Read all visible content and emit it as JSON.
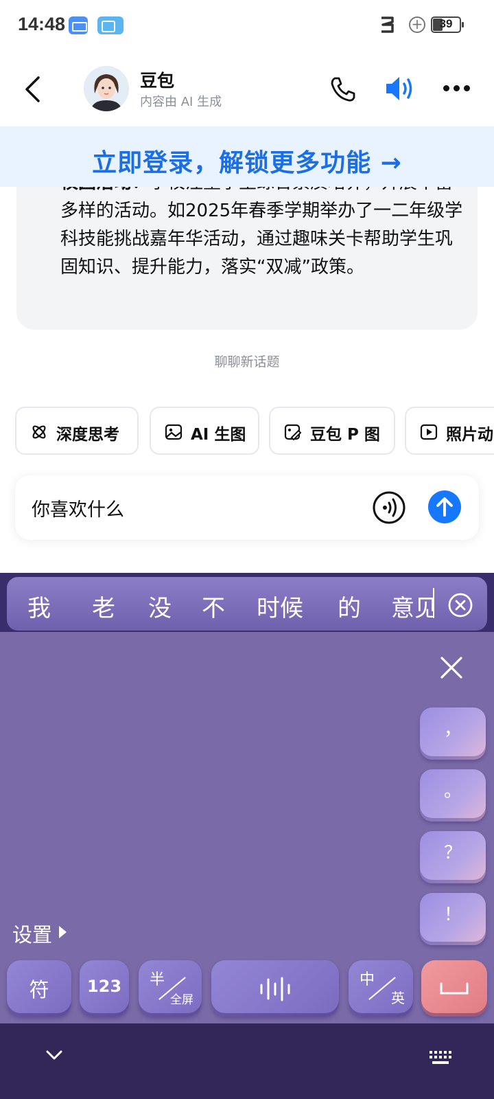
{
  "status_bar": {
    "time": "14:48",
    "battery": "39"
  },
  "header": {
    "title": "豆包",
    "subtitle": "内容由 AI 生成"
  },
  "banner": {
    "text": "立即登录，解锁更多功能 →"
  },
  "message": {
    "bold_prefix": "校园活动",
    "text": "：学校注重学生综合素质培养，开展丰富多样的活动。如2025年春季学期举办了一二年级学科技能挑战嘉年华活动，通过趣味关卡帮助学生巩固知识、提升能力，落实“双减”政策。"
  },
  "new_topic": "聊聊新话题",
  "chips": [
    {
      "label": "深度思考",
      "icon": "atom-icon"
    },
    {
      "label": "AI 生图",
      "icon": "image-icon"
    },
    {
      "label": "豆包 P 图",
      "icon": "photo-edit-icon"
    },
    {
      "label": "照片动",
      "icon": "video-icon"
    }
  ],
  "input": {
    "value": "你喜欢什么"
  },
  "keyboard": {
    "candidates": [
      "我",
      "老",
      "没",
      "不",
      "时候",
      "的",
      "意见"
    ],
    "punctuation": [
      "，",
      "。",
      "？",
      "！"
    ],
    "settings": "设置",
    "keys": {
      "symbol": "符",
      "numbers": "123",
      "half_top": "半",
      "half_bottom": "全屏",
      "lang_top": "中",
      "lang_bottom": "英"
    },
    "theme_color": "#7a6ba8",
    "enter_color": "#e9878d"
  },
  "colors": {
    "accent": "#1677ff",
    "banner_text": "#1c6ee6"
  }
}
